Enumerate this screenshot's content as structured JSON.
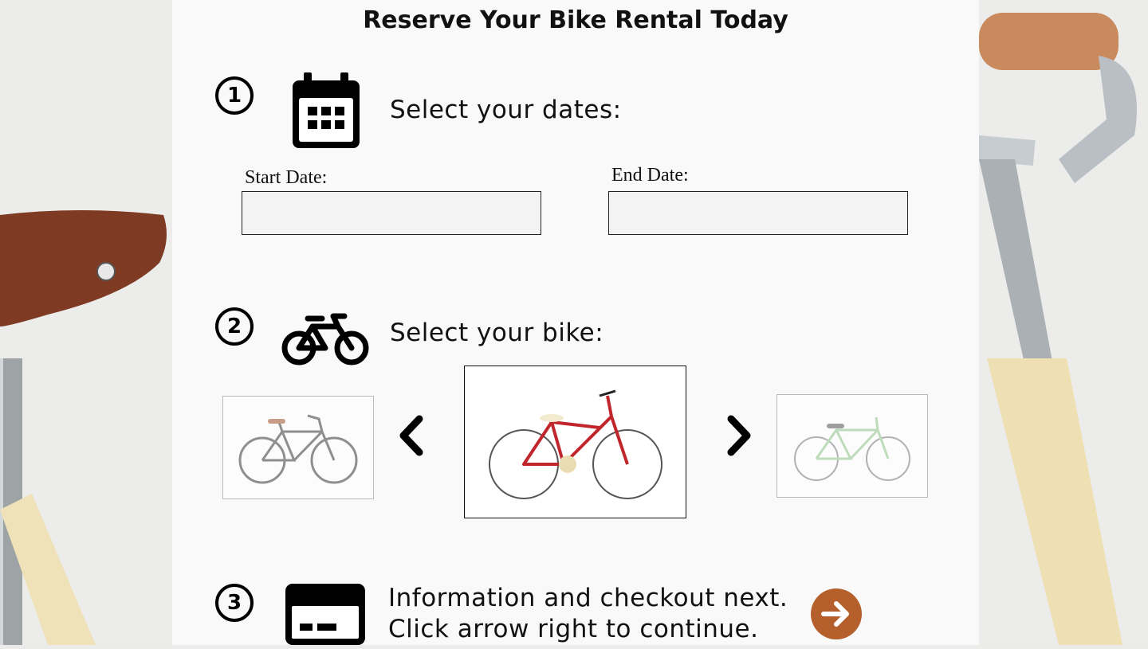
{
  "page": {
    "title": "Reserve Your Bike Rental Today"
  },
  "steps": [
    {
      "number": "1",
      "label": "Select your dates:",
      "icon": "calendar-icon"
    },
    {
      "number": "2",
      "label": "Select your bike:",
      "icon": "bicycle-icon"
    },
    {
      "number": "3",
      "label_line1": "Information and checkout next.",
      "label_line2": "Click arrow right to continue.",
      "icon": "credit-card-icon"
    }
  ],
  "dates": {
    "start_label": "Start Date:",
    "start_value": "",
    "end_label": "End Date:",
    "end_value": ""
  },
  "bike_carousel": {
    "items": [
      {
        "bike": "black-dutch-bike",
        "color": "#3a3a3a"
      },
      {
        "bike": "red-step-through-bike",
        "color": "#c0262b"
      },
      {
        "bike": "green-road-bike",
        "color": "#8fc48a"
      }
    ],
    "selected_index": 1,
    "prev_icon": "chevron-left-icon",
    "next_icon": "chevron-right-icon"
  },
  "checkout": {
    "next_icon": "arrow-right-circle-icon",
    "accent_color": "#b5602c"
  }
}
